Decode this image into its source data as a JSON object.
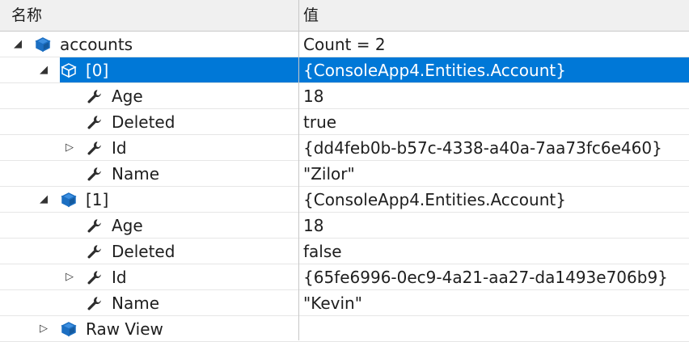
{
  "header": {
    "name_label": "名称",
    "value_label": "值"
  },
  "rows": [
    {
      "name": "accounts",
      "value": "Count = 2",
      "indent": 0,
      "expander": "expanded",
      "icon": "object-cube-icon"
    },
    {
      "name": "[0]",
      "value": "{ConsoleApp4.Entities.Account}",
      "indent": 1,
      "expander": "expanded",
      "icon": "object-cube-icon",
      "selected": true
    },
    {
      "name": "Age",
      "value": "18",
      "indent": 2,
      "expander": "none",
      "icon": "wrench-icon"
    },
    {
      "name": "Deleted",
      "value": "true",
      "indent": 2,
      "expander": "none",
      "icon": "wrench-icon"
    },
    {
      "name": "Id",
      "value": "{dd4feb0b-b57c-4338-a40a-7aa73fc6e460}",
      "indent": 2,
      "expander": "collapsed",
      "icon": "wrench-icon"
    },
    {
      "name": "Name",
      "value": "\"Zilor\"",
      "indent": 2,
      "expander": "none",
      "icon": "wrench-icon"
    },
    {
      "name": "[1]",
      "value": "{ConsoleApp4.Entities.Account}",
      "indent": 1,
      "expander": "expanded",
      "icon": "object-cube-icon"
    },
    {
      "name": "Age",
      "value": "18",
      "indent": 2,
      "expander": "none",
      "icon": "wrench-icon"
    },
    {
      "name": "Deleted",
      "value": "false",
      "indent": 2,
      "expander": "none",
      "icon": "wrench-icon"
    },
    {
      "name": "Id",
      "value": "{65fe6996-0ec9-4a21-aa27-da1493e706b9}",
      "indent": 2,
      "expander": "collapsed",
      "icon": "wrench-icon"
    },
    {
      "name": "Name",
      "value": "\"Kevin\"",
      "indent": 2,
      "expander": "none",
      "icon": "wrench-icon"
    },
    {
      "name": "Raw View",
      "value": "",
      "indent": 1,
      "expander": "collapsed",
      "icon": "object-cube-icon"
    }
  ],
  "colors": {
    "selection": "#0078d7",
    "cube": "#1c6fc2",
    "wrench": "#2d2d2d"
  }
}
